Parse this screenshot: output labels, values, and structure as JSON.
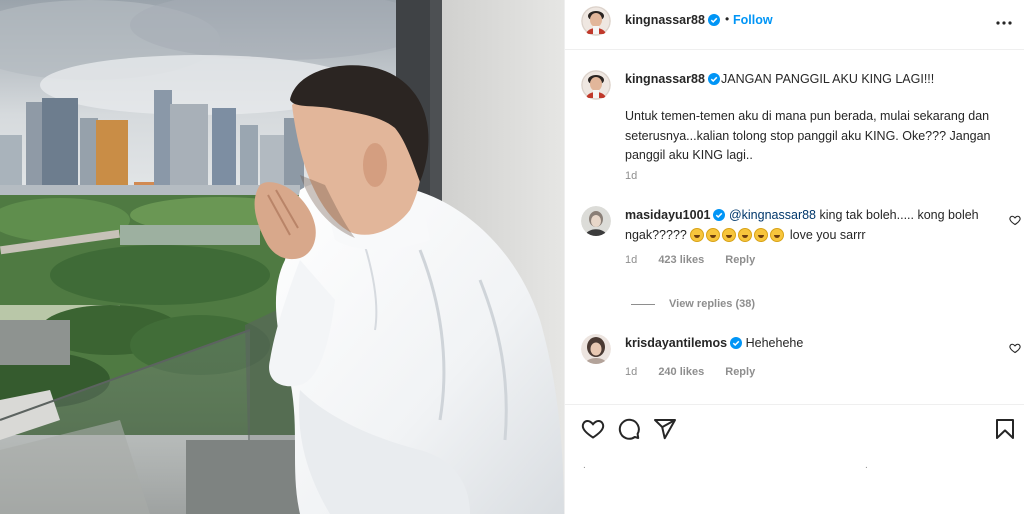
{
  "post": {
    "author": "kingnassar88",
    "follow_label": "Follow",
    "dot": "•",
    "brand": {
      "accent": "#0095f6",
      "verified": "#0095f6"
    }
  },
  "caption": {
    "username": "kingnassar88",
    "title": "JANGAN PANGGIL AKU KING LAGI!!!",
    "body": "Untuk temen-temen aku di mana pun berada, mulai sekarang dan seterusnya...kalian tolong stop panggil aku KING. Oke??? Jangan panggil aku KING lagi..",
    "time": "1d"
  },
  "comments": [
    {
      "username": "masidayu1001",
      "mention": "@kingnassar88",
      "text_before_emoji": "king tak boleh..... kong boleh ngak?????",
      "emoji_count": 6,
      "text_after_emoji": "love you sarrr",
      "time": "1d",
      "likes": "423 likes",
      "reply": "Reply"
    },
    {
      "username": "krisdayantilemos",
      "text": "Hehehehe",
      "time": "1d",
      "likes": "240 likes",
      "reply": "Reply"
    }
  ],
  "view_replies": "View replies (38)",
  "actions": {
    "icons": [
      "heart-icon",
      "comment-icon",
      "share-icon",
      "bookmark-icon"
    ]
  },
  "bottom": {
    "dots": "."
  }
}
